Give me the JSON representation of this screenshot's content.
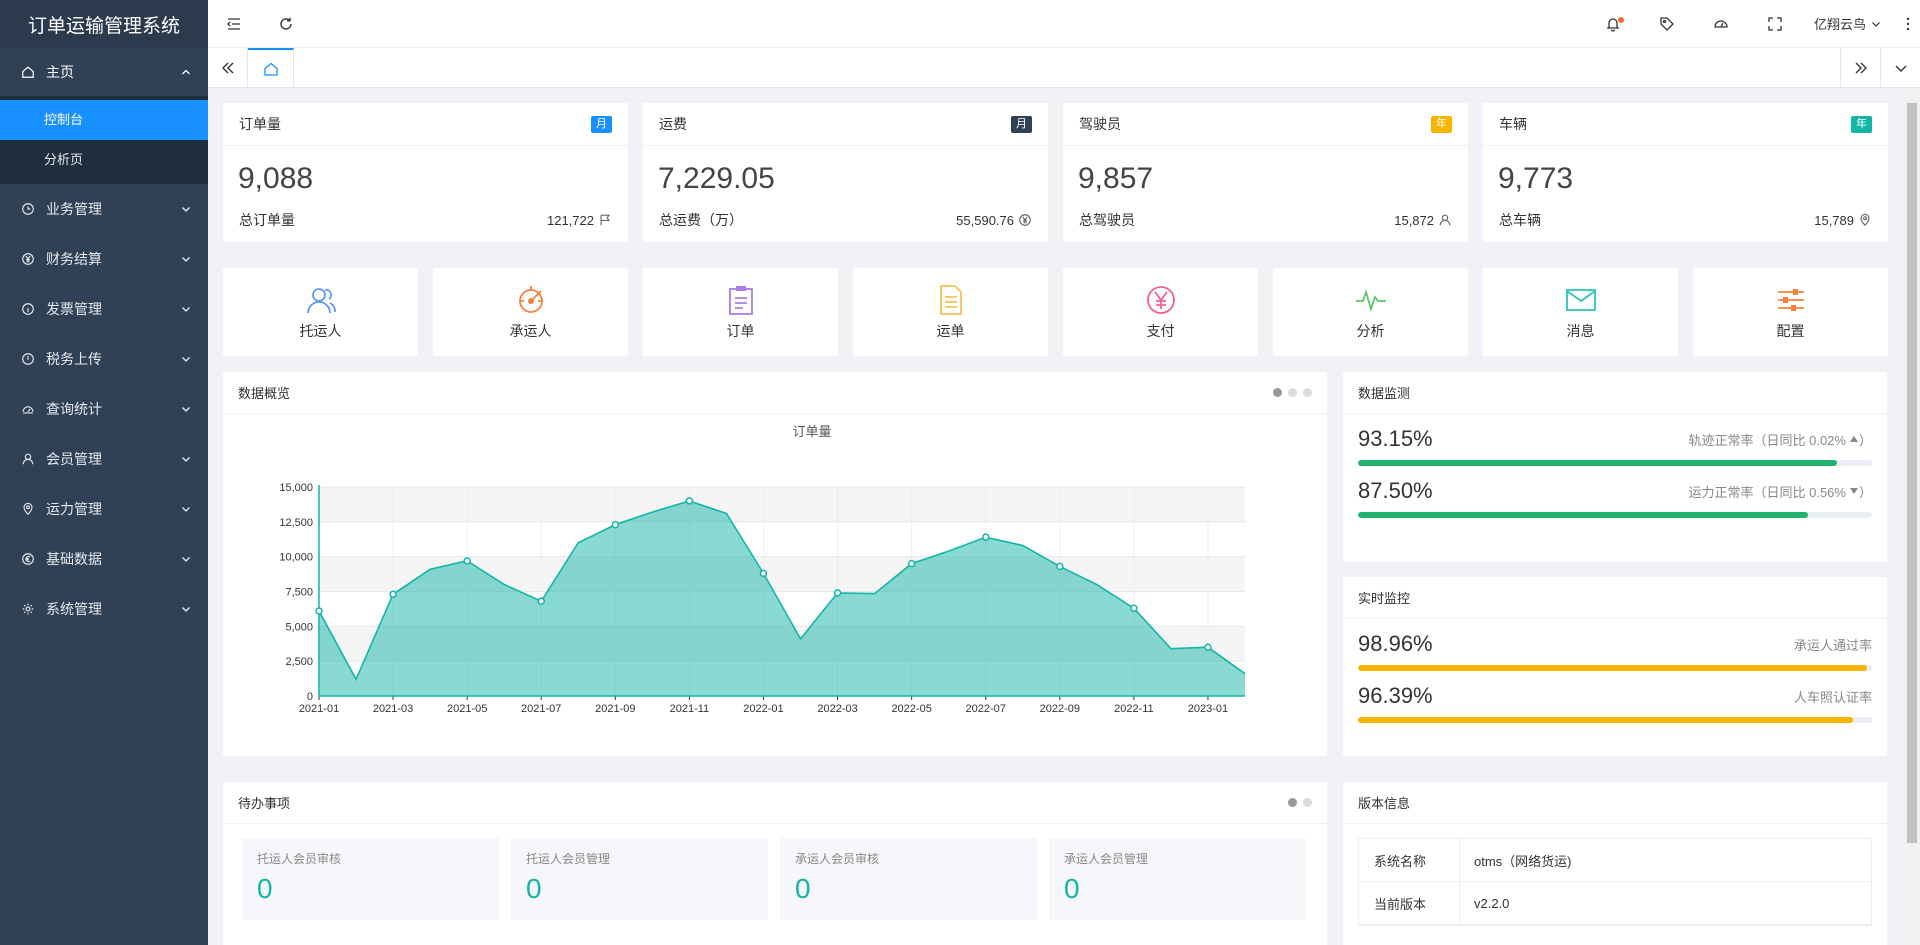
{
  "app": {
    "title": "订单运输管理系统"
  },
  "sidebar": {
    "home": {
      "label": "主页",
      "children": [
        {
          "label": "控制台",
          "active": true
        },
        {
          "label": "分析页"
        }
      ]
    },
    "items": [
      {
        "label": "业务管理",
        "icon": "clock-icon"
      },
      {
        "label": "财务结算",
        "icon": "yen-circle-icon"
      },
      {
        "label": "发票管理",
        "icon": "info-circle-icon"
      },
      {
        "label": "税务上传",
        "icon": "exclamation-circle-icon"
      },
      {
        "label": "查询统计",
        "icon": "dashboard-icon"
      },
      {
        "label": "会员管理",
        "icon": "user-icon"
      },
      {
        "label": "运力管理",
        "icon": "location-icon"
      },
      {
        "label": "基础数据",
        "icon": "euro-circle-icon"
      },
      {
        "label": "系统管理",
        "icon": "gear-icon"
      }
    ]
  },
  "topbar": {
    "user": "亿翔云鸟"
  },
  "stats": [
    {
      "title": "订单量",
      "badge": "月",
      "badge_color": "#1890ff",
      "value": "9,088",
      "foot_label": "总订单量",
      "foot_value": "121,722",
      "icon": "flag-icon"
    },
    {
      "title": "运费",
      "badge": "月",
      "badge_color": "#304156",
      "value": "7,229.05",
      "foot_label": "总运费（万）",
      "foot_value": "55,590.76",
      "icon": "yen-circle-icon"
    },
    {
      "title": "驾驶员",
      "badge": "年",
      "badge_color": "#f7b500",
      "value": "9,857",
      "foot_label": "总驾驶员",
      "foot_value": "15,872",
      "icon": "user-icon"
    },
    {
      "title": "车辆",
      "badge": "年",
      "badge_color": "#13b5a7",
      "value": "9,773",
      "foot_label": "总车辆",
      "foot_value": "15,789",
      "icon": "location-icon"
    }
  ],
  "quick": [
    {
      "label": "托运人",
      "icon": "users-icon",
      "color": "#5b9bf5"
    },
    {
      "label": "承运人",
      "icon": "target-icon",
      "color": "#f5813b"
    },
    {
      "label": "订单",
      "icon": "clipboard-icon",
      "color": "#a77ee8"
    },
    {
      "label": "运单",
      "icon": "document-icon",
      "color": "#f7c35a"
    },
    {
      "label": "支付",
      "icon": "yen-circle-icon",
      "color": "#f06292"
    },
    {
      "label": "分析",
      "icon": "pulse-icon",
      "color": "#5cc36b"
    },
    {
      "label": "消息",
      "icon": "mail-icon",
      "color": "#2ec4b6"
    },
    {
      "label": "配置",
      "icon": "sliders-icon",
      "color": "#f5813b"
    }
  ],
  "overview": {
    "title": "数据概览"
  },
  "chart_data": {
    "type": "area",
    "title": "订单量",
    "x": [
      "2021-01",
      "2021-02",
      "2021-03",
      "2021-04",
      "2021-05",
      "2021-06",
      "2021-07",
      "2021-08",
      "2021-09",
      "2021-10",
      "2021-11",
      "2021-12",
      "2022-01",
      "2022-02",
      "2022-03",
      "2022-04",
      "2022-05",
      "2022-06",
      "2022-07",
      "2022-08",
      "2022-09",
      "2022-10",
      "2022-11",
      "2022-12",
      "2023-01",
      "2023-02"
    ],
    "xticks": [
      "2021-01",
      "2021-03",
      "2021-05",
      "2021-07",
      "2021-09",
      "2021-11",
      "2022-01",
      "2022-03",
      "2022-05",
      "2022-07",
      "2022-09",
      "2022-11",
      "2023-01"
    ],
    "values": [
      6100,
      1200,
      7300,
      9100,
      9700,
      8000,
      6800,
      11000,
      12300,
      13200,
      14000,
      13100,
      8800,
      4100,
      7400,
      7350,
      9500,
      10400,
      11400,
      10800,
      9300,
      8000,
      6300,
      3400,
      3500,
      1600
    ],
    "yticks": [
      "0",
      "2,500",
      "5,000",
      "7,500",
      "10,000",
      "12,500",
      "15,000"
    ],
    "ylim": [
      0,
      15000
    ],
    "color": "#13b5a7",
    "grid": true
  },
  "monitor": {
    "title": "数据监测",
    "rows": [
      {
        "value": "93.15%",
        "label": "轨迹正常率（日同比 0.02%",
        "pct": 0.9315,
        "color": "#20b36b",
        "trend": "up"
      },
      {
        "value": "87.50%",
        "label": "运力正常率（日同比 0.56%",
        "pct": 0.875,
        "color": "#20b36b",
        "trend": "down"
      }
    ]
  },
  "realtime": {
    "title": "实时监控",
    "rows": [
      {
        "value": "98.96%",
        "label": "承运人通过率",
        "pct": 0.9896,
        "color": "#f7b500"
      },
      {
        "value": "96.39%",
        "label": "人车照认证率",
        "pct": 0.9639,
        "color": "#f7b500"
      }
    ]
  },
  "todo": {
    "title": "待办事项",
    "items": [
      {
        "label": "托运人会员审核",
        "value": "0"
      },
      {
        "label": "托运人会员管理",
        "value": "0"
      },
      {
        "label": "承运人会员审核",
        "value": "0"
      },
      {
        "label": "承运人会员管理",
        "value": "0"
      }
    ]
  },
  "version": {
    "title": "版本信息",
    "rows": [
      {
        "key": "系统名称",
        "value": "otms（网络货运)"
      },
      {
        "key": "当前版本",
        "value": "v2.2.0"
      }
    ]
  }
}
